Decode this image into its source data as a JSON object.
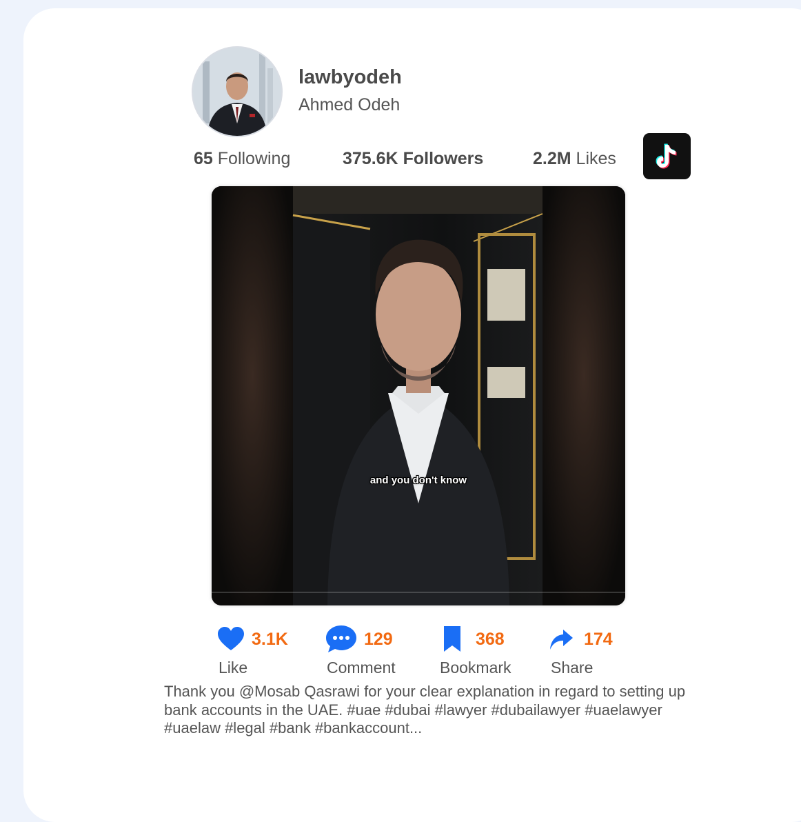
{
  "profile": {
    "username": "lawbyodeh",
    "display_name": "Ahmed Odeh"
  },
  "stats": {
    "following_count": "65",
    "following_label": "Following",
    "followers_count": "375.6K",
    "followers_label": "Followers",
    "likes_count": "2.2M",
    "likes_label": "Likes"
  },
  "video": {
    "subtitle": "and you don't know"
  },
  "actions": {
    "like_count": "3.1K",
    "like_label": "Like",
    "comment_count": "129",
    "comment_label": "Comment",
    "bookmark_count": "368",
    "bookmark_label": "Bookmark",
    "share_count": "174",
    "share_label": "Share"
  },
  "description": "Thank you @Mosab Qasrawi for your clear explanation in regard to setting up bank accounts in the UAE. #uae #dubai #lawyer #dubailawyer #uaelawyer #uaelaw #legal #bank #bankaccount...",
  "icons": {
    "avatar": "profile-photo",
    "platform": "tiktok-logo-icon",
    "like": "heart-icon",
    "comment": "chat-bubble-icon",
    "bookmark": "bookmark-icon",
    "share": "share-arrow-icon"
  },
  "colors": {
    "accent_count": "#f26a12",
    "icon_blue": "#1a6ef5",
    "page_background": "#eef3fc"
  }
}
